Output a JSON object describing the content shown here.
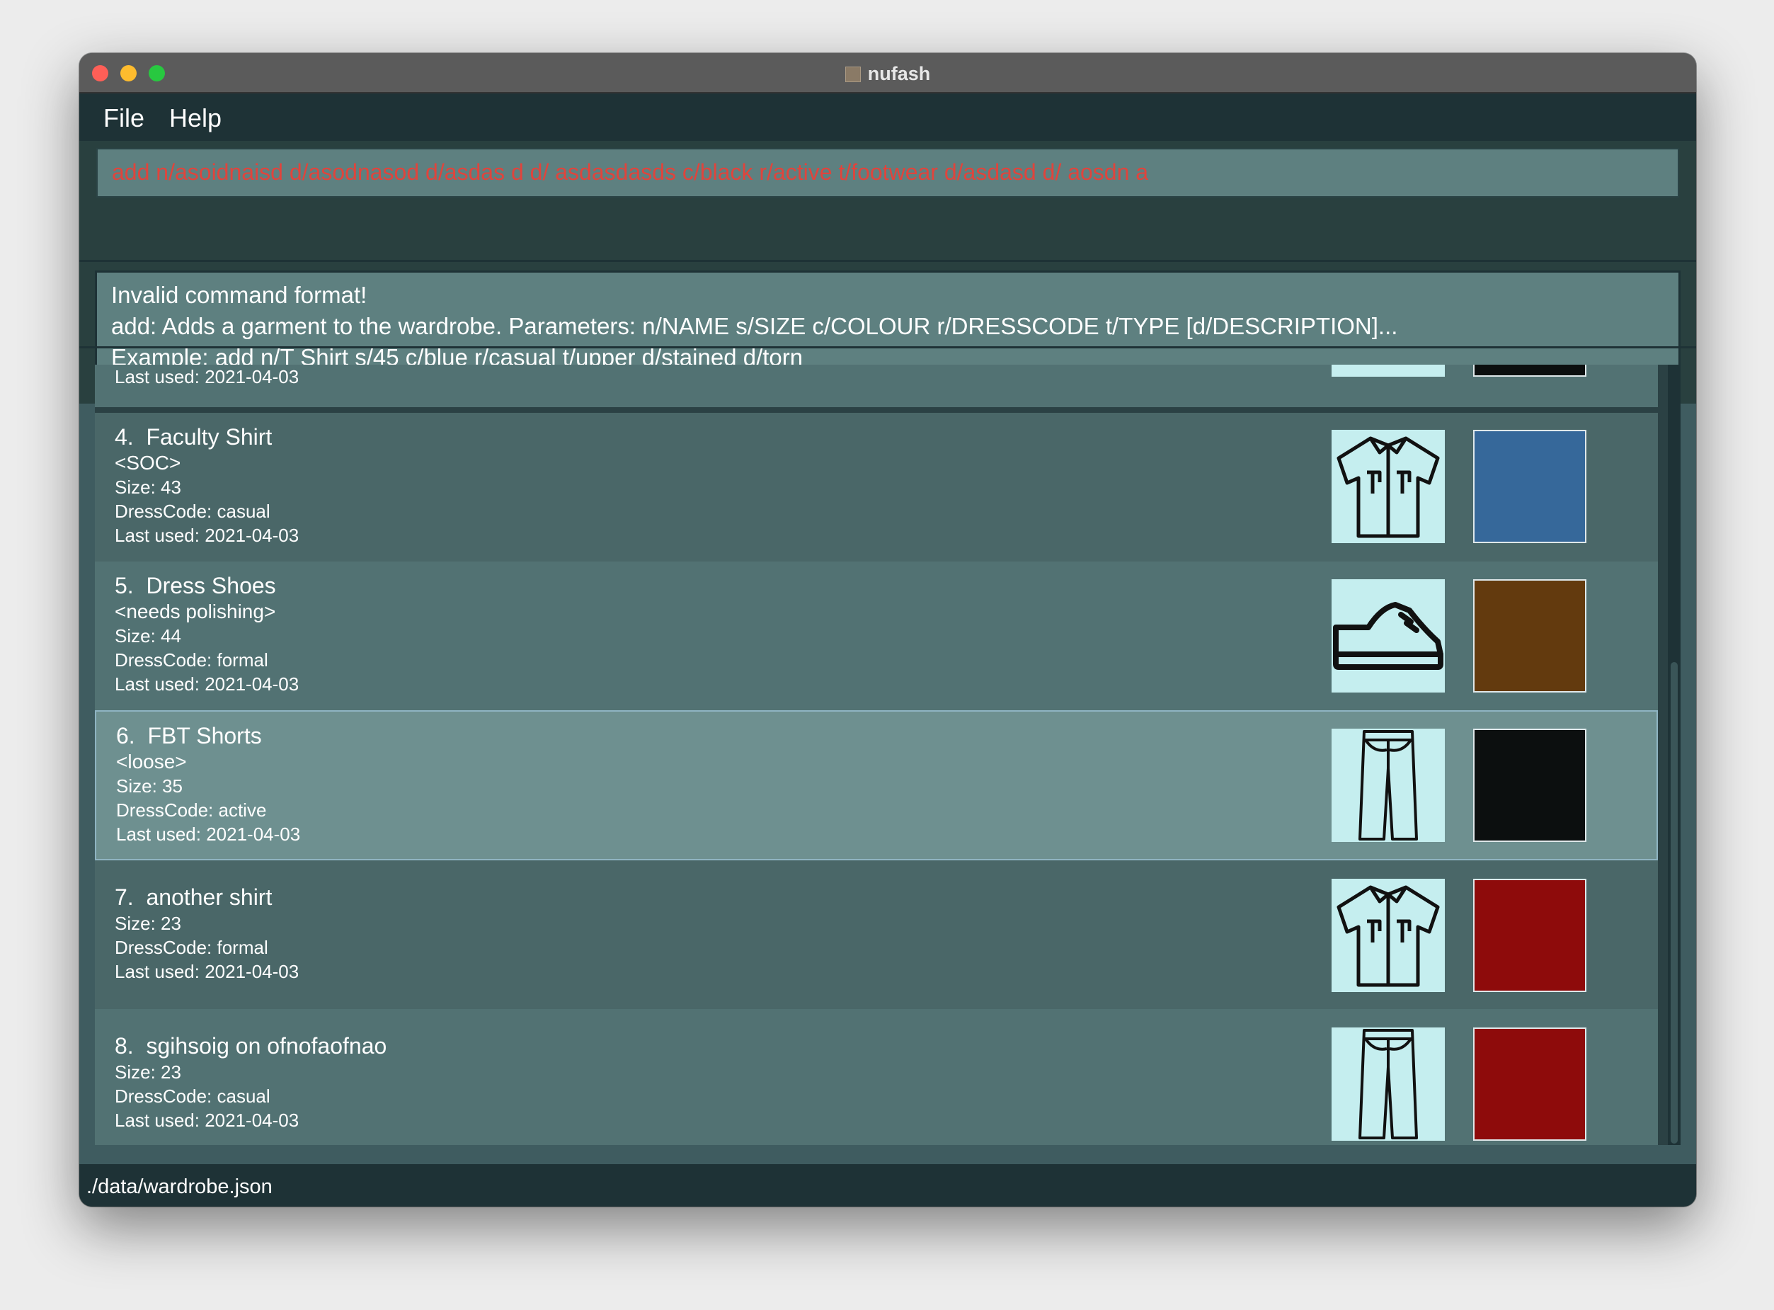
{
  "window": {
    "title": "nufash"
  },
  "menu": {
    "file": "File",
    "help": "Help"
  },
  "command": {
    "value": "add n/asoidnaisd d/asodnasod d/asdas d d/ asdasdasds c/black r/active t/footwear d/asdasd d/  aosdn a"
  },
  "result": {
    "line1": "Invalid command format!",
    "line2": "add: Adds a garment to the wardrobe. Parameters: n/NAME s/SIZE c/COLOUR r/DRESSCODE t/TYPE [d/DESCRIPTION]...",
    "line3": "Example: add n/T Shirt s/45 c/blue r/casual t/upper d/stained d/torn"
  },
  "partial_row": {
    "last_used": "Last used: 2021-04-03"
  },
  "garments": [
    {
      "index": "4.",
      "name": "Faculty Shirt",
      "description": "<SOC>",
      "size": "Size: 43",
      "dresscode": "DressCode: casual",
      "last_used": "Last used: 2021-04-03",
      "type_icon": "shirt-icon",
      "colour": "#36689a"
    },
    {
      "index": "5.",
      "name": "Dress Shoes",
      "description": "<needs polishing>",
      "size": "Size: 44",
      "dresscode": "DressCode: formal",
      "last_used": "Last used: 2021-04-03",
      "type_icon": "shoe-icon",
      "colour": "#633a0e"
    },
    {
      "index": "6.",
      "name": "FBT Shorts",
      "description": "<loose>",
      "size": "Size: 35",
      "dresscode": "DressCode: active",
      "last_used": "Last used: 2021-04-03",
      "type_icon": "pants-icon",
      "colour": "#0c0f0f"
    },
    {
      "index": "7.",
      "name": "another shirt",
      "size": "Size: 23",
      "dresscode": "DressCode: formal",
      "last_used": "Last used: 2021-04-03",
      "type_icon": "shirt-icon",
      "colour": "#8e0b0b"
    },
    {
      "index": "8.",
      "name": "sgihsoig on ofnofaofnao",
      "size": "Size: 23",
      "dresscode": "DressCode: casual",
      "last_used": "Last used: 2021-04-03",
      "type_icon": "pants-icon",
      "colour": "#8e0b0b"
    }
  ],
  "status": {
    "path": "./data/wardrobe.json"
  }
}
